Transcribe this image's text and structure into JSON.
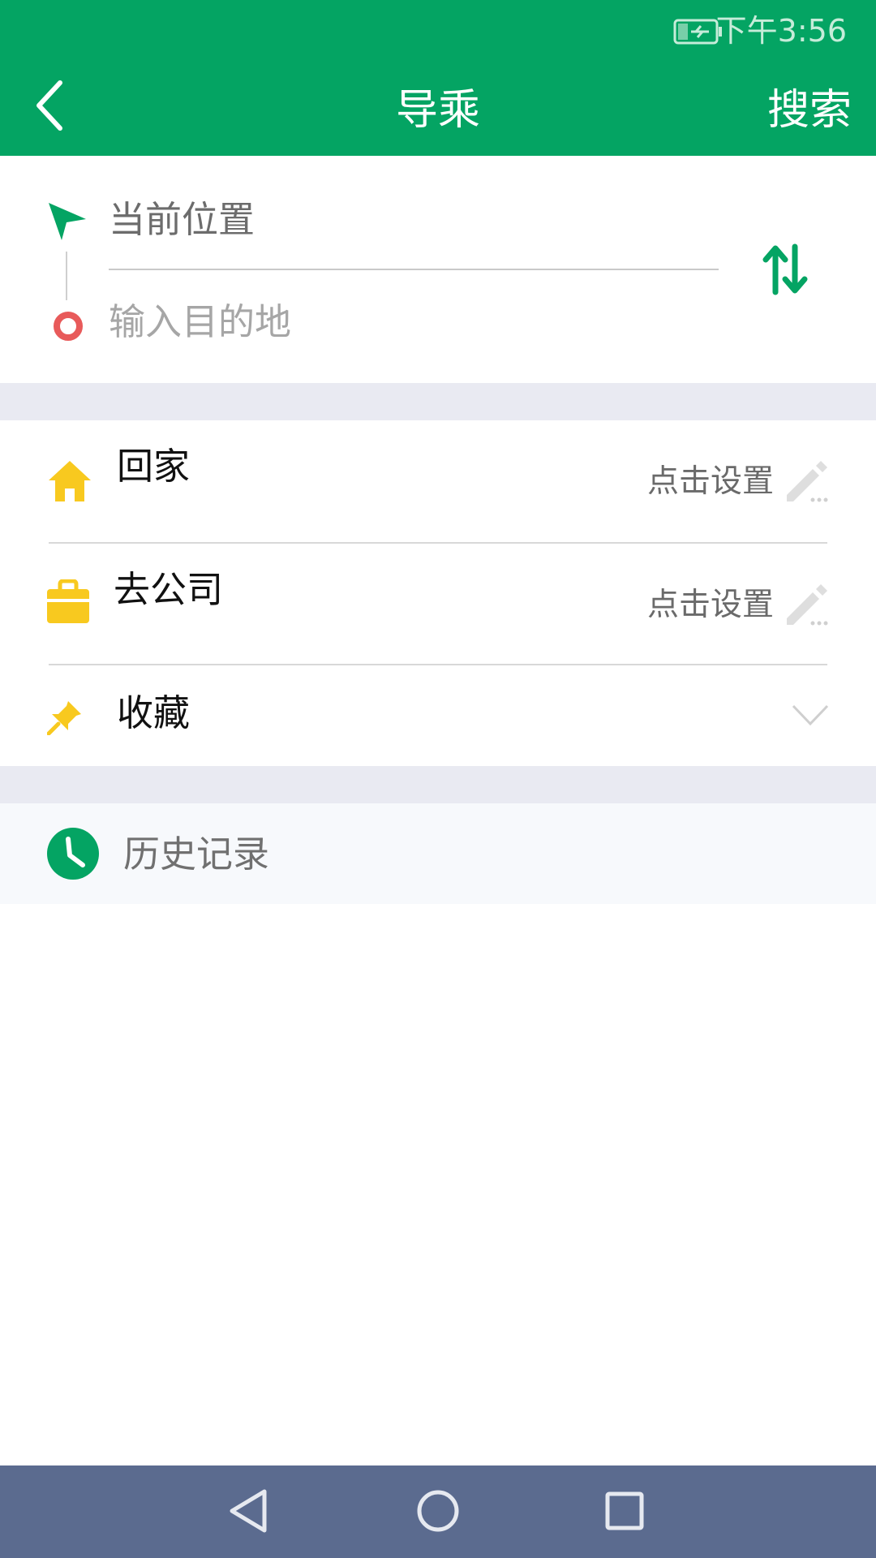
{
  "status_bar": {
    "time": "下午3:56",
    "icons": [
      "battery-charging-icon"
    ]
  },
  "header": {
    "title": "导乘",
    "search_label": "搜索",
    "back_icon": "chevron-left-icon"
  },
  "route": {
    "start_value": "当前位置",
    "destination_placeholder": "输入目的地",
    "icons": [
      "navigation-arrow-icon",
      "destination-ring-icon",
      "swap-arrows-icon"
    ]
  },
  "quick": {
    "home": {
      "label": "回家",
      "action": "点击设置",
      "icon": "house-icon"
    },
    "work": {
      "label": "去公司",
      "action": "点击设置",
      "icon": "briefcase-icon"
    },
    "favorites": {
      "label": "收藏",
      "icon": "pin-icon"
    }
  },
  "history": {
    "label": "历史记录",
    "icon": "clock-icon"
  },
  "colors": {
    "brand_green": "#04a463",
    "home_yellow": "#f8c91f",
    "destination_red": "#e85a5a",
    "nav_bar": "#5b6b8f"
  }
}
